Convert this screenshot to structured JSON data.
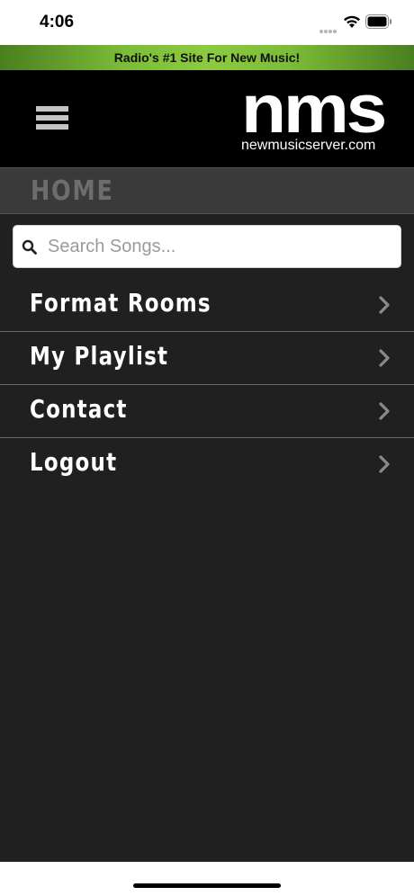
{
  "status_bar": {
    "time": "4:06",
    "icons": [
      "cellular-dots-icon",
      "wifi-icon",
      "battery-icon"
    ]
  },
  "tagline": "Radio's #1 Site For New Music!",
  "header": {
    "menu_icon": "hamburger-icon",
    "logo_mark": "nms",
    "logo_url": "newmusicserver.com"
  },
  "page": {
    "title": "HOME"
  },
  "search": {
    "placeholder": "Search Songs...",
    "value": "",
    "icon": "search-icon"
  },
  "menu": {
    "items": [
      {
        "label": "Format Rooms",
        "icon": "chevron-right-icon"
      },
      {
        "label": "My Playlist",
        "icon": "chevron-right-icon"
      },
      {
        "label": "Contact",
        "icon": "chevron-right-icon"
      },
      {
        "label": "Logout",
        "icon": "chevron-right-icon"
      }
    ]
  },
  "colors": {
    "tagline_green": "#7bbc38",
    "header_bg": "#000000",
    "home_bar_bg": "#3a3a3a",
    "content_bg": "#202020",
    "menu_text": "#ffffff",
    "chevron": "#8a8a8a"
  }
}
